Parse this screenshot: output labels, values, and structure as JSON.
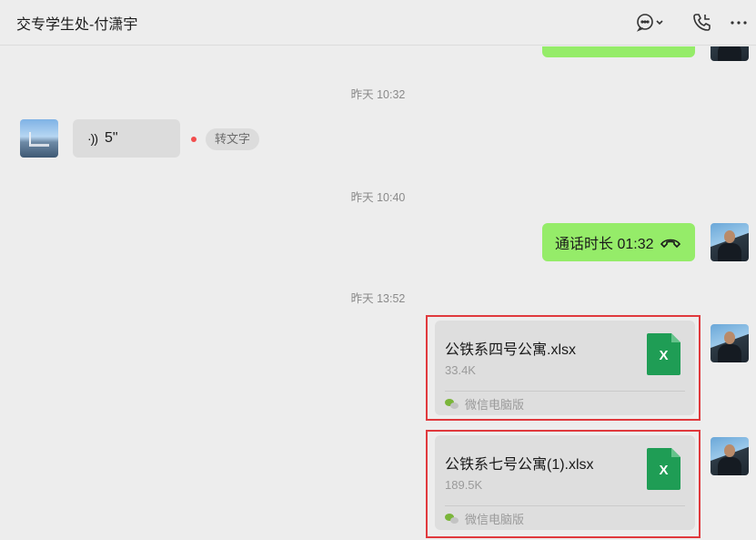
{
  "header": {
    "title": "交专学生处-付潇宇",
    "icons": [
      "chat-bubble-dropdown-icon",
      "phone-icon",
      "more-icon"
    ]
  },
  "messages": {
    "ts1": "昨天 10:32",
    "voice": {
      "wave": "·))",
      "duration": "5\"",
      "to_text": "转文字"
    },
    "ts2": "昨天 10:40",
    "call": {
      "text": "通话时长 01:32"
    },
    "ts3": "昨天 13:52",
    "files": [
      {
        "name": "公铁系四号公寓.xlsx",
        "size": "33.4K",
        "source": "微信电脑版",
        "icon_letter": "X"
      },
      {
        "name": "公铁系七号公寓(1).xlsx",
        "size": "189.5K",
        "source": "微信电脑版",
        "icon_letter": "X"
      }
    ]
  },
  "colors": {
    "my_bubble": "#95ec69",
    "other_bubble": "#dcdcdc",
    "file_card": "#dedede",
    "excel_green": "#1f9d55",
    "highlight": "#e0393d"
  }
}
